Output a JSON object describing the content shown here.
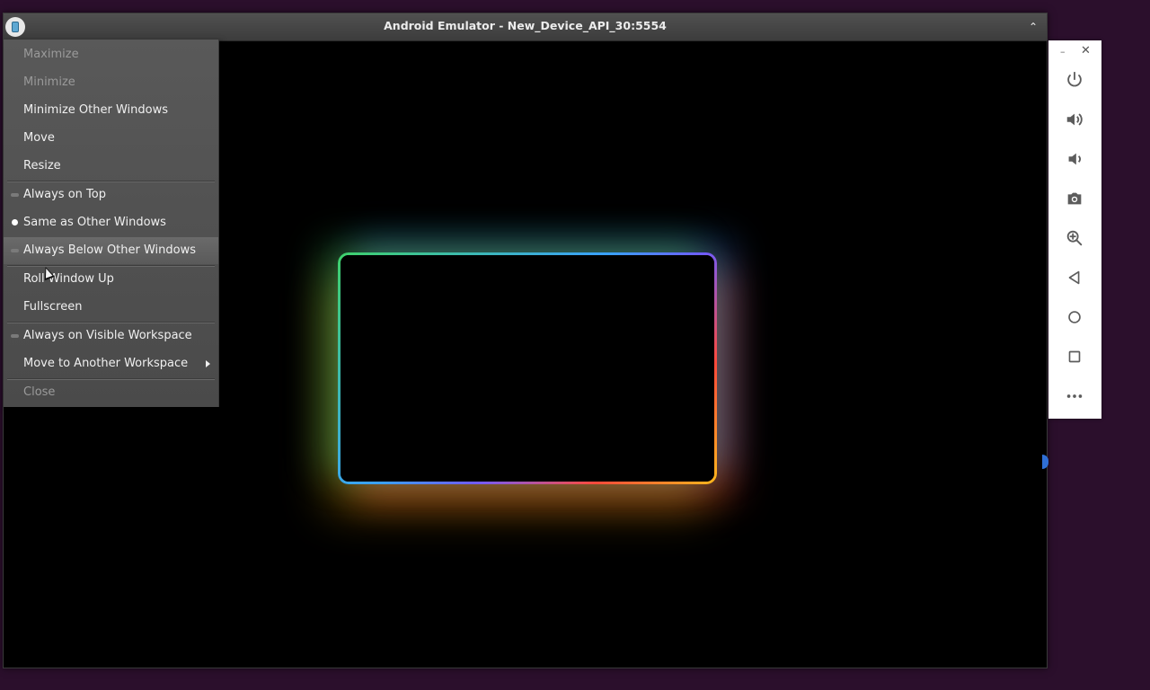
{
  "window": {
    "title": "Android Emulator - New_Device_API_30:5554",
    "collapse_glyph": "⌃"
  },
  "menu": {
    "items": [
      {
        "label": "Maximize",
        "disabled": true
      },
      {
        "label": "Minimize",
        "disabled": true
      },
      {
        "label": "Minimize Other Windows",
        "disabled": false
      },
      {
        "label": "Move",
        "disabled": false
      },
      {
        "label": "Resize",
        "disabled": false
      },
      {
        "label": "Always on Top",
        "disabled": false,
        "radio": "off"
      },
      {
        "label": "Same as Other Windows",
        "disabled": false,
        "radio": "on"
      },
      {
        "label": "Always Below Other Windows",
        "disabled": false,
        "radio": "off",
        "hover": true
      },
      {
        "label": "Roll Window Up",
        "disabled": false
      },
      {
        "label": "Fullscreen",
        "disabled": false
      },
      {
        "label": "Always on Visible Workspace",
        "disabled": false,
        "radio": "off"
      },
      {
        "label": "Move to Another Workspace",
        "disabled": false,
        "submenu": true
      },
      {
        "label": "Close",
        "disabled": true
      }
    ]
  },
  "toolbar": {
    "minimize_glyph": "–",
    "close_glyph": "✕",
    "buttons": [
      "power-icon",
      "volume-up-icon",
      "volume-down-icon",
      "camera-icon",
      "zoom-icon",
      "back-icon",
      "home-icon",
      "overview-icon",
      "more-icon"
    ]
  },
  "colors": {
    "desktop": "#2b0f2c",
    "menu_bg": "#4f4f4f",
    "glow_green": "#3fd16a",
    "glow_blue": "#3aa0ff",
    "glow_red": "#ff4a3a",
    "glow_yellow": "#ffb81c"
  }
}
